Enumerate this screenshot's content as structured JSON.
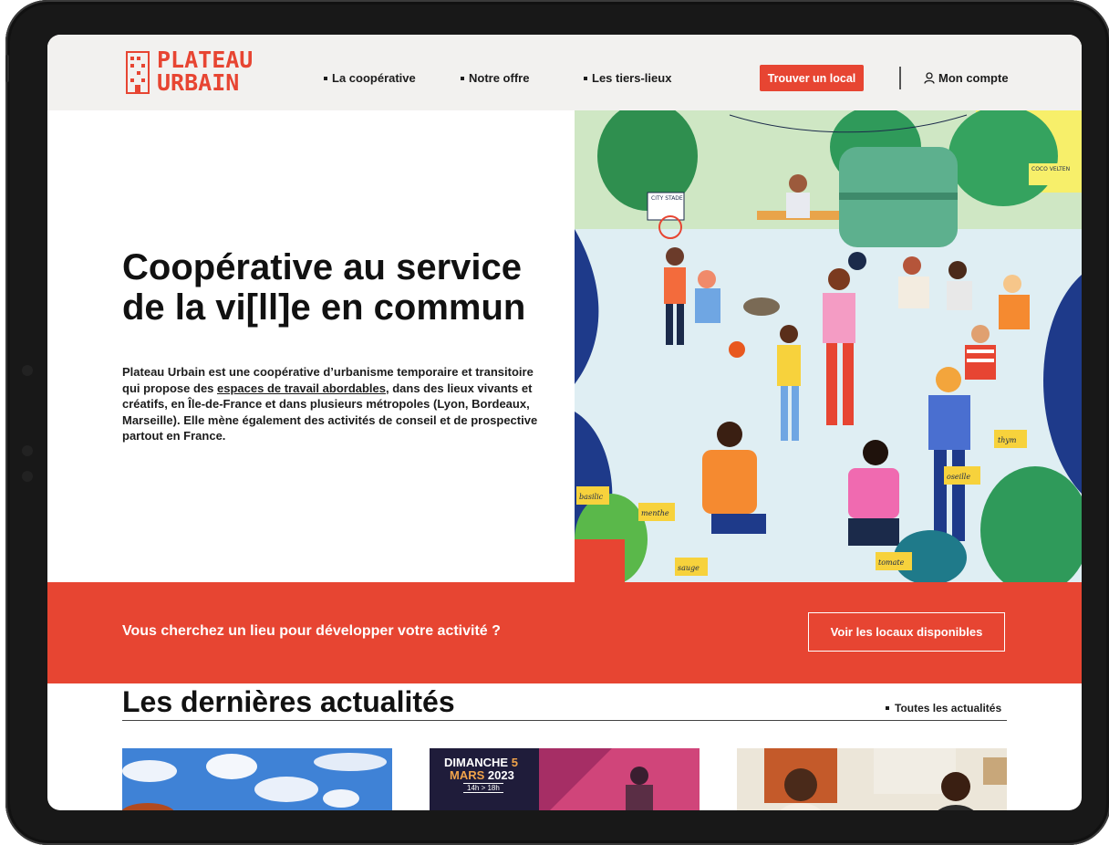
{
  "header": {
    "logo_line1": "PLATEAU",
    "logo_line2": "URBAIN",
    "nav": [
      {
        "label": "La coopérative"
      },
      {
        "label": "Notre offre"
      },
      {
        "label": "Les tiers-lieux"
      }
    ],
    "cta_label": "Trouver un local",
    "account_label": "Mon compte"
  },
  "hero": {
    "title": "Coopérative au service de la vi[ll]e en commun",
    "intro_before": "Plateau Urbain est une coopérative d’urbanisme temporaire et transitoire qui propose des ",
    "intro_link": "espaces de travail abordables",
    "intro_after": ", dans des lieux vivants et créatifs, en Île-de-France et dans plusieurs métropoles (Lyon, Bordeaux, Marseille). Elle mène également des activités de conseil et de prospective partout en France.",
    "illustration_signs": {
      "city_stade": "CITY STADE",
      "coco": "COCO VELTEN",
      "basilic": "basilic",
      "menthe": "menthe",
      "sauge": "sauge",
      "tomate": "tomate",
      "thym": "thym",
      "oseille": "oseille"
    }
  },
  "cta_band": {
    "text": "Vous cherchez un lieu pour développer votre activité ?",
    "button": "Voir les locaux disponibles"
  },
  "news": {
    "title": "Les dernières actualités",
    "all_link": "Toutes les actualités",
    "event": {
      "day": "DIMANCHE",
      "day_num": "5",
      "month": "MARS",
      "year": "2023",
      "hours": "14h > 18h"
    }
  },
  "colors": {
    "brand_red": "#e74532",
    "header_bg": "#f2f1ef",
    "device_frame": "#181818"
  }
}
